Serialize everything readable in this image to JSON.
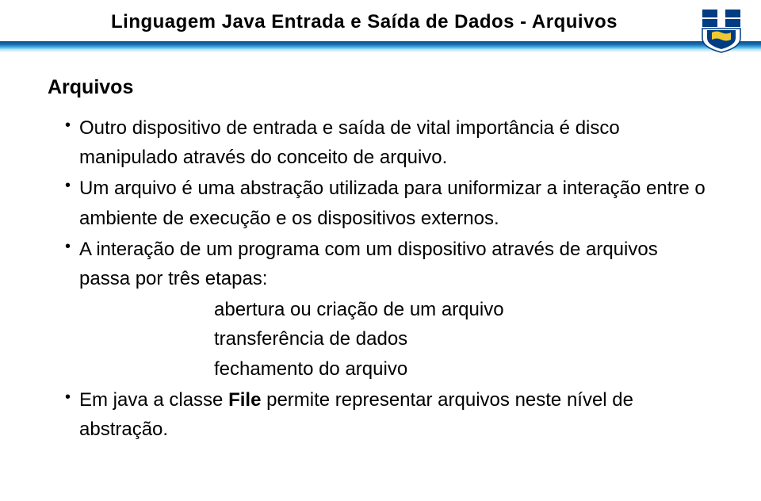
{
  "header": {
    "title": "Linguagem Java Entrada e Saída de Dados - Arquivos"
  },
  "content": {
    "section_title": "Arquivos",
    "bullets": [
      "Outro dispositivo de entrada e saída de vital importância é disco manipulado através do conceito de arquivo.",
      "Um arquivo é uma abstração utilizada para uniformizar a interação entre o ambiente de execução e os dispositivos externos.",
      "A interação de um programa com um dispositivo através de arquivos passa por três etapas:"
    ],
    "sublist": [
      "abertura ou criação de um arquivo",
      "transferência de dados",
      "fechamento do arquivo"
    ],
    "last_bullet_pre": "Em java a classe ",
    "last_bullet_bold": "File",
    "last_bullet_post": " permite representar arquivos neste nível de abstração."
  }
}
